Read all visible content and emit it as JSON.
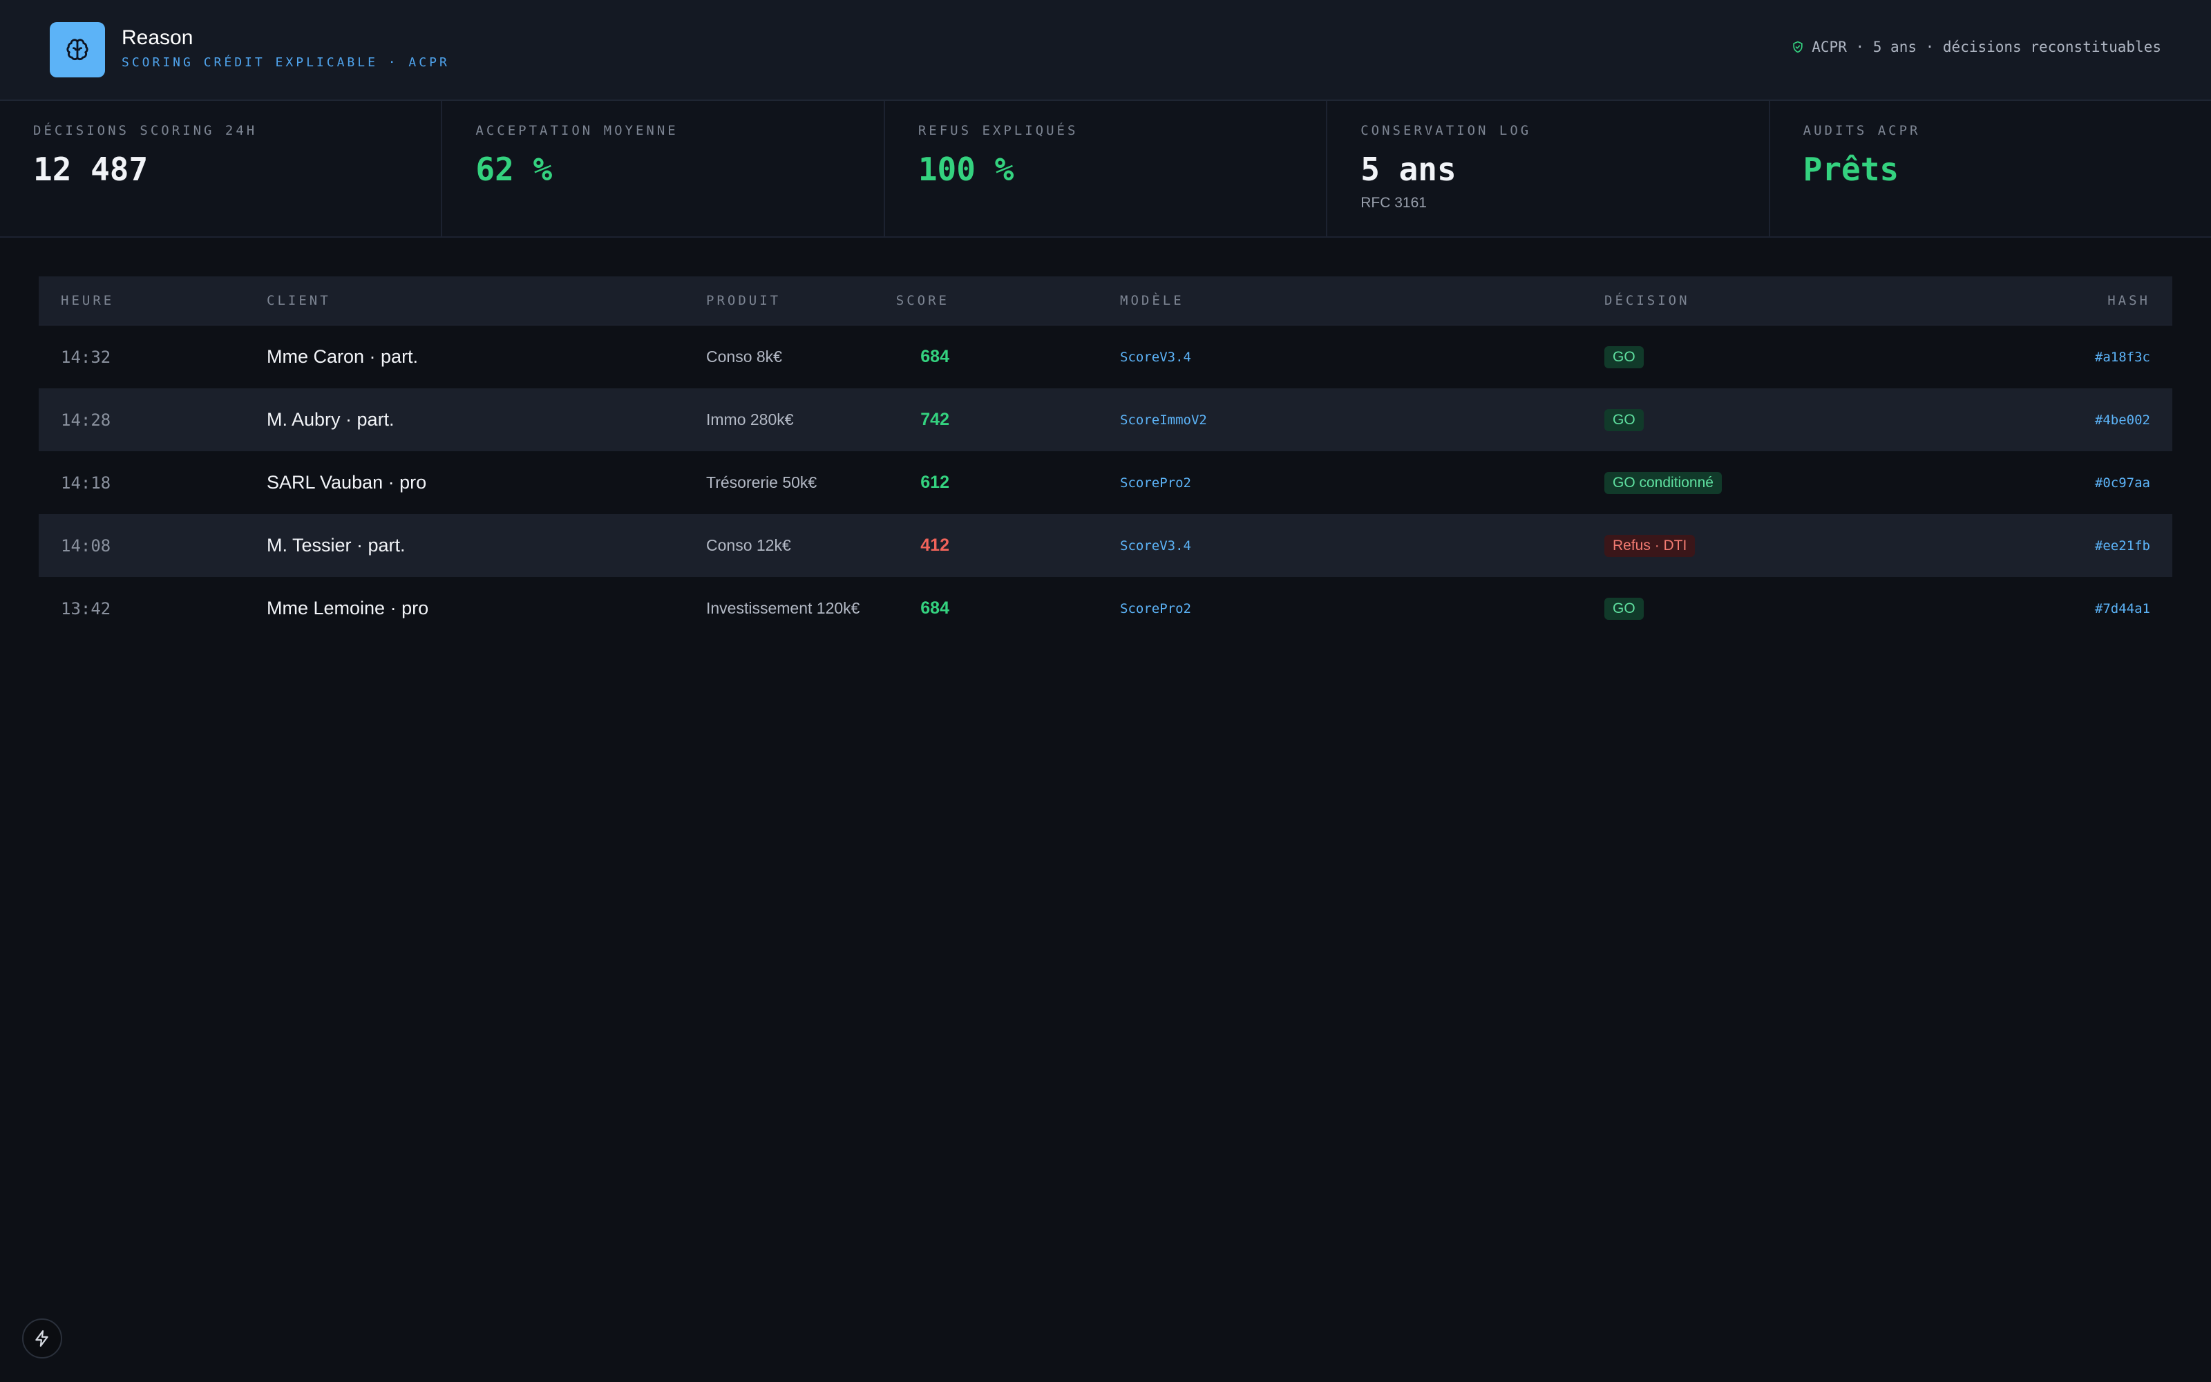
{
  "app": {
    "title": "Reason",
    "subtitle": "SCORING CRÉDIT EXPLICABLE · ACPR",
    "logo_icon": "brain-icon",
    "compliance_text": "ACPR · 5 ans · décisions reconstituables",
    "compliance_icon": "shield-check-icon"
  },
  "colors": {
    "accent": "#5cb3f7",
    "positive": "#34d27f",
    "negative": "#f0635a",
    "background": "#0d1016"
  },
  "kpis": [
    {
      "label": "Décisions scoring 24h",
      "value": "12 487",
      "note": "",
      "tone": "neutral"
    },
    {
      "label": "Acceptation moyenne",
      "value": "62 %",
      "note": "",
      "tone": "green"
    },
    {
      "label": "Refus expliqués",
      "value": "100 %",
      "note": "",
      "tone": "green"
    },
    {
      "label": "Conservation log",
      "value": "5 ans",
      "note": "RFC 3161",
      "tone": "neutral"
    },
    {
      "label": "Audits ACPR",
      "value": "Prêts",
      "note": "",
      "tone": "green"
    }
  ],
  "table": {
    "headers": {
      "time": "HEURE",
      "client": "CLIENT",
      "product": "PRODUIT",
      "model": "MODÈLE",
      "score": "SCORE",
      "decision": "DÉCISION",
      "hash": "HASH"
    },
    "rows": [
      {
        "time": "14:32",
        "client": "Mme Caron · part.",
        "product": "Conso 8k€",
        "model": "ScoreV3.4",
        "score": "684",
        "decision": "GO",
        "decision_type": "go",
        "hash": "#a18f3c"
      },
      {
        "time": "14:28",
        "client": "M. Aubry · part.",
        "product": "Immo 280k€",
        "model": "ScoreImmoV2",
        "score": "742",
        "decision": "GO",
        "decision_type": "go",
        "hash": "#4be002"
      },
      {
        "time": "14:18",
        "client": "SARL Vauban · pro",
        "product": "Trésorerie 50k€",
        "model": "ScorePro2",
        "score": "612",
        "decision": "GO conditionné",
        "decision_type": "go",
        "hash": "#0c97aa"
      },
      {
        "time": "14:08",
        "client": "M. Tessier · part.",
        "product": "Conso 12k€",
        "model": "ScoreV3.4",
        "score": "412",
        "decision": "Refus · DTI",
        "decision_type": "refus",
        "hash": "#ee21fb"
      },
      {
        "time": "13:42",
        "client": "Mme Lemoine · pro",
        "product": "Investissement 120k€",
        "model": "ScorePro2",
        "score": "684",
        "decision": "GO",
        "decision_type": "go",
        "hash": "#7d44a1"
      }
    ]
  },
  "fab": {
    "icon": "lightning-icon"
  }
}
